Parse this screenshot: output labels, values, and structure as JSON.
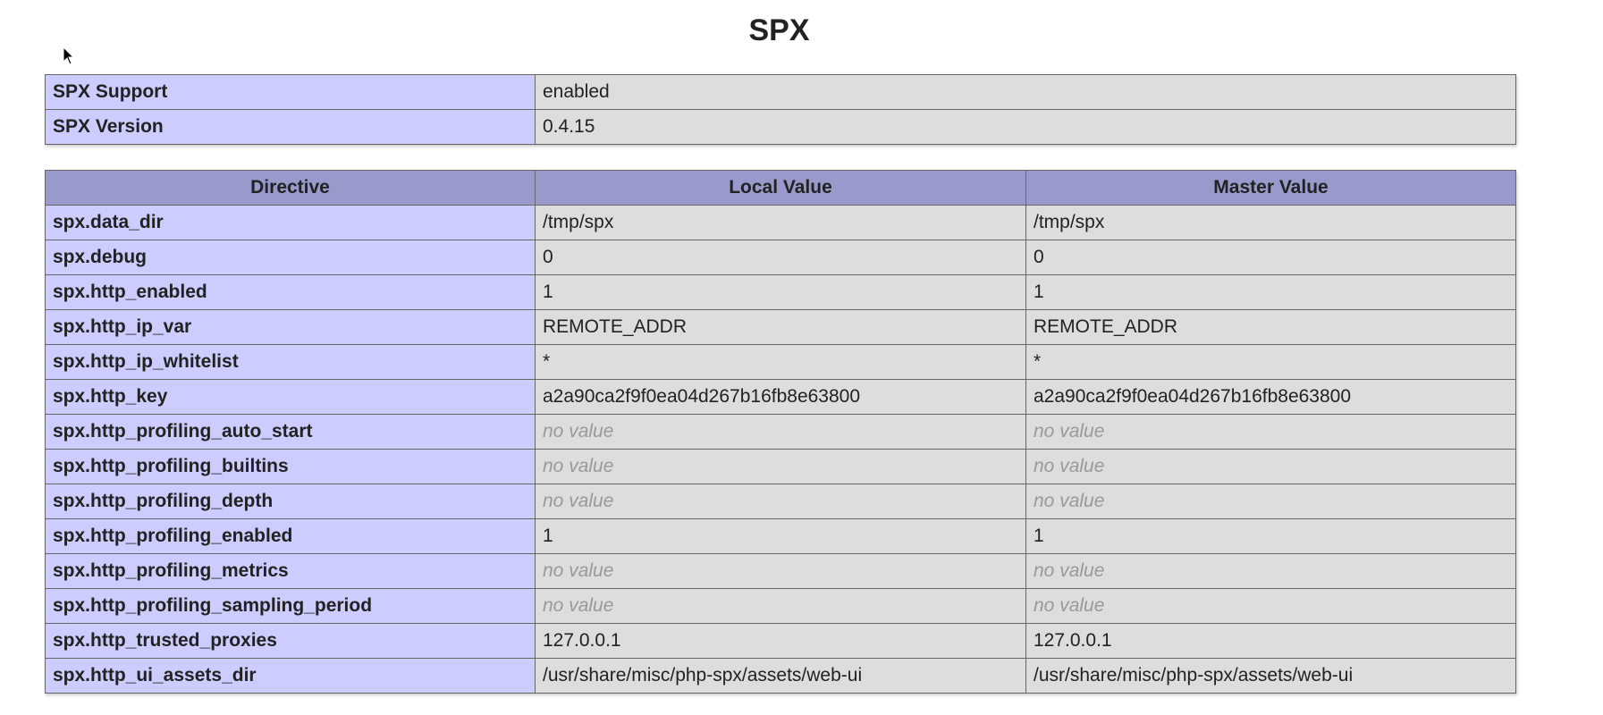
{
  "page": {
    "title": "SPX"
  },
  "info_rows": [
    {
      "label": "SPX Support",
      "value": "enabled"
    },
    {
      "label": "SPX Version",
      "value": "0.4.15"
    }
  ],
  "directives": {
    "headers": [
      "Directive",
      "Local Value",
      "Master Value"
    ],
    "rows": [
      {
        "name": "spx.data_dir",
        "local": "/tmp/spx",
        "master": "/tmp/spx",
        "no_value": false
      },
      {
        "name": "spx.debug",
        "local": "0",
        "master": "0",
        "no_value": false
      },
      {
        "name": "spx.http_enabled",
        "local": "1",
        "master": "1",
        "no_value": false
      },
      {
        "name": "spx.http_ip_var",
        "local": "REMOTE_ADDR",
        "master": "REMOTE_ADDR",
        "no_value": false
      },
      {
        "name": "spx.http_ip_whitelist",
        "local": "*",
        "master": "*",
        "no_value": false
      },
      {
        "name": "spx.http_key",
        "local": "a2a90ca2f9f0ea04d267b16fb8e63800",
        "master": "a2a90ca2f9f0ea04d267b16fb8e63800",
        "no_value": false
      },
      {
        "name": "spx.http_profiling_auto_start",
        "local": "no value",
        "master": "no value",
        "no_value": true
      },
      {
        "name": "spx.http_profiling_builtins",
        "local": "no value",
        "master": "no value",
        "no_value": true
      },
      {
        "name": "spx.http_profiling_depth",
        "local": "no value",
        "master": "no value",
        "no_value": true
      },
      {
        "name": "spx.http_profiling_enabled",
        "local": "1",
        "master": "1",
        "no_value": false
      },
      {
        "name": "spx.http_profiling_metrics",
        "local": "no value",
        "master": "no value",
        "no_value": true
      },
      {
        "name": "spx.http_profiling_sampling_period",
        "local": "no value",
        "master": "no value",
        "no_value": true
      },
      {
        "name": "spx.http_trusted_proxies",
        "local": "127.0.0.1",
        "master": "127.0.0.1",
        "no_value": false
      },
      {
        "name": "spx.http_ui_assets_dir",
        "local": "/usr/share/misc/php-spx/assets/web-ui",
        "master": "/usr/share/misc/php-spx/assets/web-ui",
        "no_value": false
      }
    ]
  },
  "colors": {
    "header_bg": "#9999cc",
    "label_bg": "#ccccff",
    "value_bg": "#dddddd",
    "no_value_text": "#999999"
  },
  "icons": {
    "cursor": "mouse-pointer-icon"
  }
}
